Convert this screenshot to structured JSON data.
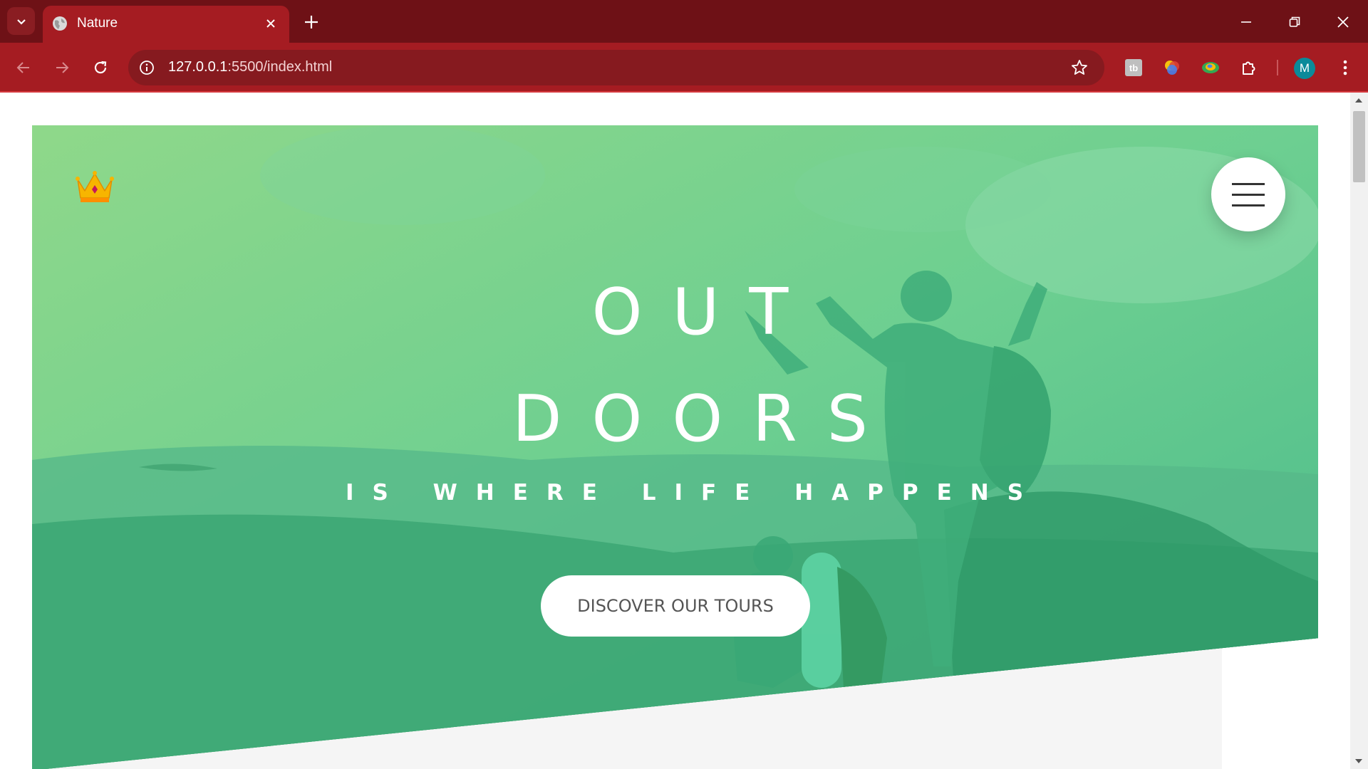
{
  "browser": {
    "tab": {
      "title": "Nature"
    },
    "url": {
      "host": "127.0.0.1",
      "path": ":5500/index.html"
    },
    "profile_initial": "M",
    "colors": {
      "tabbar": "#6e1116",
      "toolbar": "#a51c22"
    },
    "icons": {
      "tab_list": "chevron-down-icon",
      "favicon": "globe-icon",
      "tab_close": "close-icon",
      "new_tab": "plus-icon",
      "minimize": "minimize-icon",
      "restore": "restore-icon",
      "close_window": "close-icon",
      "back": "arrow-left-icon",
      "forward": "arrow-right-icon",
      "reload": "reload-icon",
      "site_info": "info-icon",
      "bookmark": "star-icon",
      "extensions": [
        "tb-extension-icon",
        "color-extension-icon",
        "globe-extension-icon",
        "puzzle-icon"
      ],
      "menu": "kebab-menu-icon"
    }
  },
  "page": {
    "logo": "crown-icon",
    "menu_button": "hamburger-icon",
    "heading": {
      "line1": "OUT",
      "line2": "DOORS",
      "subtitle": "IS WHERE LIFE HAPPENS"
    },
    "cta_label": "DISCOVER OUR TOURS",
    "colors": {
      "gradient_start": "#7ed56f",
      "gradient_end": "#28b485",
      "section_bg": "#f5f5f5"
    }
  }
}
